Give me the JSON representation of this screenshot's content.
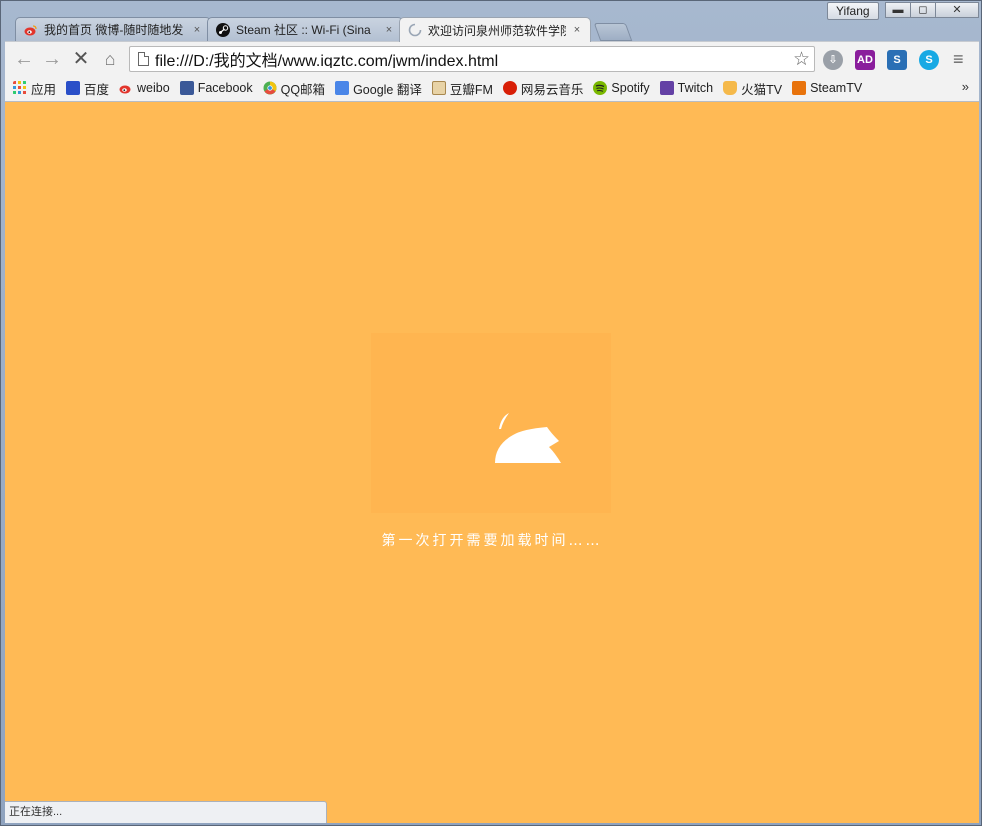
{
  "window": {
    "profile_name": "Yifang",
    "minimize_glyph": "▬",
    "maximize_glyph": "◻",
    "close_glyph": "✕"
  },
  "tabs": [
    {
      "title": "我的首页 微博-随时随地发",
      "favicon": "weibo-icon",
      "close": "×"
    },
    {
      "title": "Steam 社区 :: Wi-Fi (Sina",
      "favicon": "steam-icon",
      "close": "×"
    },
    {
      "title": "欢迎访问泉州师范软件学院",
      "favicon": "loading-spinner-icon",
      "close": "×",
      "active": true
    }
  ],
  "toolbar": {
    "back": "←",
    "forward": "→",
    "stop": "✕",
    "home": "⌂",
    "url": "file:///D:/我的文档/www.iqztc.com/jwm/index.html",
    "star": "☆",
    "menu": "≡"
  },
  "extensions": [
    {
      "name": "download-helper-icon",
      "label": "⇩",
      "color": "#8a8f98"
    },
    {
      "name": "adblock-icon",
      "label": "AD",
      "color": "#8a1d9c"
    },
    {
      "name": "s-extension-icon",
      "label": "S",
      "color": "#2a6fb5"
    },
    {
      "name": "skype-icon",
      "label": "S",
      "color": "#17a9e4"
    }
  ],
  "bookmarks": [
    {
      "label": "应用",
      "icon": "apps-grid-icon",
      "color": "#e84c3d"
    },
    {
      "label": "百度",
      "icon": "baidu-paw-icon",
      "color": "#2a4fc8"
    },
    {
      "label": "weibo",
      "icon": "weibo-icon",
      "color": "#e2352c"
    },
    {
      "label": "Facebook",
      "icon": "facebook-icon",
      "color": "#3b5998"
    },
    {
      "label": "QQ邮箱",
      "icon": "chrome-style-icon",
      "color": "#4caf50"
    },
    {
      "label": "Google 翻译",
      "icon": "google-translate-icon",
      "color": "#4a86e8"
    },
    {
      "label": "豆瓣FM",
      "icon": "douban-fm-icon",
      "color": "#c9a46a"
    },
    {
      "label": "网易云音乐",
      "icon": "netease-music-icon",
      "color": "#d81e06"
    },
    {
      "label": "Spotify",
      "icon": "spotify-icon",
      "color": "#7ab800"
    },
    {
      "label": "Twitch",
      "icon": "twitch-icon",
      "color": "#6441a5"
    },
    {
      "label": "火猫TV",
      "icon": "huomao-cat-icon",
      "color": "#f5a623"
    },
    {
      "label": "SteamTV",
      "icon": "steamtv-icon",
      "color": "#e8730c"
    }
  ],
  "bookmarks_more": "»",
  "page": {
    "background": "#ffba55",
    "loading_text": "第一次打开需要加载时间……"
  },
  "status": {
    "text": "正在连接..."
  }
}
